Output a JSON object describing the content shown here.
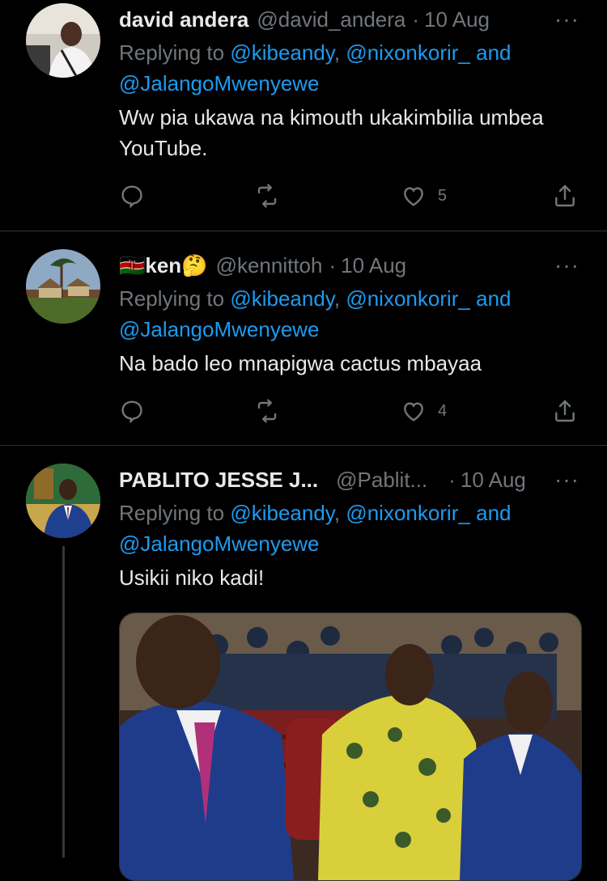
{
  "tweets": [
    {
      "name": "david andera",
      "handle": "@david_andera",
      "separator": "·",
      "date": "10 Aug",
      "reply_prefix": "Replying to",
      "reply_user1": "@kibeandy",
      "reply_comma": ",",
      "reply_user2": "@nixonkorir_",
      "reply_and": "and",
      "reply_user3": "@JalangoMwenyewe",
      "text_line1": "Ww pia ukawa na kimouth ukakimbilia umbea",
      "text_line2": "YouTube.",
      "like_count": "5",
      "more": "···"
    },
    {
      "name_flag": "🇰🇪",
      "name": "ken",
      "name_emoji": "🤔",
      "handle": "@kennittoh",
      "separator": "·",
      "date": "10 Aug",
      "reply_prefix": "Replying to",
      "reply_user1": "@kibeandy",
      "reply_comma": ",",
      "reply_user2": "@nixonkorir_",
      "reply_and": "and",
      "reply_user3": "@JalangoMwenyewe",
      "text_line1": "Na bado leo mnapigwa cactus mbayaa",
      "like_count": "4",
      "more": "···"
    },
    {
      "name": "PABLITO JESSE J...",
      "handle": "@Pablit...",
      "separator": "·",
      "date": "10 Aug",
      "reply_prefix": "Replying to",
      "reply_user1": "@kibeandy",
      "reply_comma": ",",
      "reply_user2": "@nixonkorir_",
      "reply_and": "and",
      "reply_user3": "@JalangoMwenyewe",
      "text_line1": "Usikii niko kadi!",
      "more": "···"
    }
  ],
  "icons": {
    "reply": "reply-icon",
    "retweet": "retweet-icon",
    "like": "heart-icon",
    "share": "share-icon",
    "more": "more-icon"
  },
  "colors": {
    "background": "#000000",
    "primary_text": "#e7e9ea",
    "secondary_text": "#71767b",
    "mention": "#1d9bf0",
    "divider": "#2f3336"
  }
}
